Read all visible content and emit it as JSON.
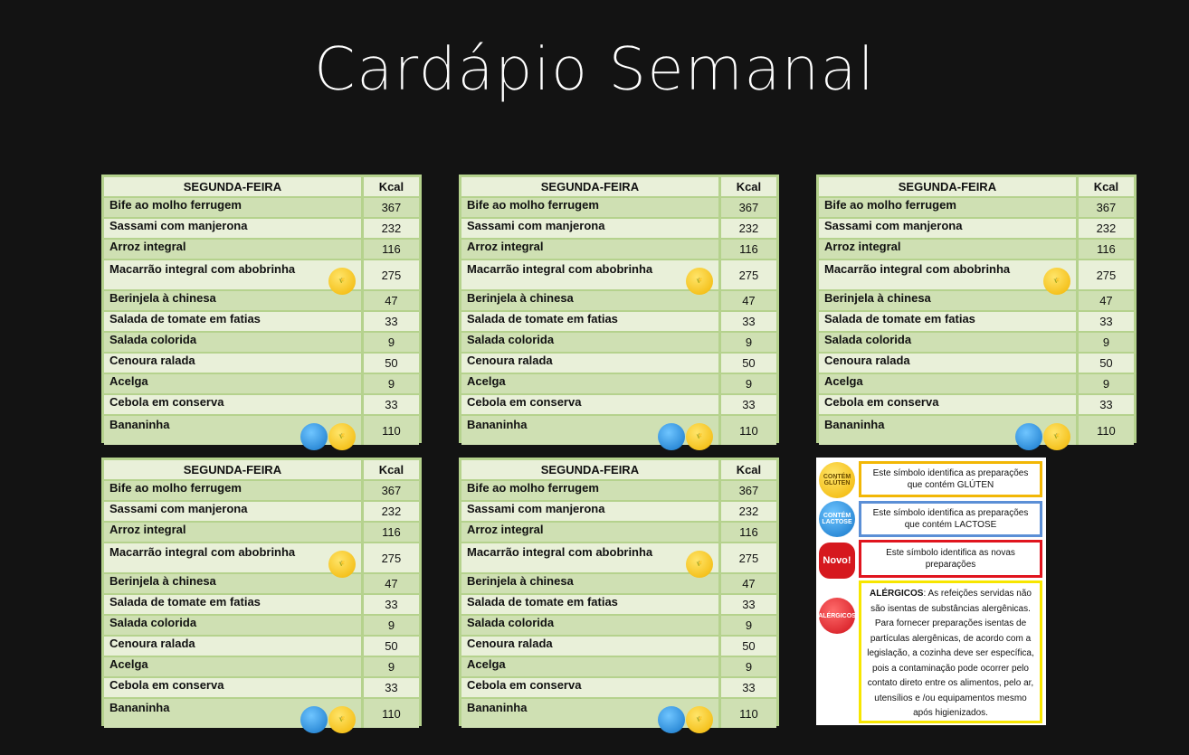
{
  "page": {
    "title": "Cardápio Semanal"
  },
  "menu": {
    "day_header": "SEGUNDA-FEIRA",
    "kcal_header": "Kcal",
    "items": [
      {
        "name": "Bife ao molho ferrugem",
        "kcal": "367",
        "badges": []
      },
      {
        "name": "Sassami com manjerona",
        "kcal": "232",
        "badges": []
      },
      {
        "name": "Arroz integral",
        "kcal": "116",
        "badges": []
      },
      {
        "name": "Macarrão integral com abobrinha",
        "kcal": "275",
        "badges": [
          "gluten"
        ]
      },
      {
        "name": "Berinjela à chinesa",
        "kcal": "47",
        "badges": []
      },
      {
        "name": "Salada de tomate em fatias",
        "kcal": "33",
        "badges": []
      },
      {
        "name": "Salada colorida",
        "kcal": "9",
        "badges": []
      },
      {
        "name": "Cenoura ralada",
        "kcal": "50",
        "badges": []
      },
      {
        "name": "Acelga",
        "kcal": "9",
        "badges": []
      },
      {
        "name": "Cebola em conserva",
        "kcal": "33",
        "badges": []
      },
      {
        "name": "Bananinha",
        "kcal": "110",
        "badges": [
          "lactose",
          "gluten"
        ]
      }
    ]
  },
  "badge_labels": {
    "gluten": "CONTÉM GLÚTEN",
    "lactose": "CONTÉM LACTOSE"
  },
  "legend": {
    "gluten": {
      "icon_label": "CONTÉM GLÚTEN",
      "text": "Este símbolo identifica as preparações que contém GLÚTEN",
      "color": "#f2b705"
    },
    "lactose": {
      "icon_label": "CONTÉM LACTOSE",
      "text": "Este símbolo identifica as preparações que contém LACTOSE",
      "color": "#5b8fd6"
    },
    "novo": {
      "icon_label": "Novo!",
      "text": "Este símbolo identifica as novas preparações",
      "color": "#e0141e"
    },
    "alergicos": {
      "icon_label": "ALÉRGICOS",
      "title": "ALÉRGICOS",
      "text": ": As refeições servidas não são isentas de substâncias alergênicas. Para fornecer preparações isentas de partículas alergênicas, de acordo com a legislação, a cozinha deve ser específica, pois a contaminação pode ocorrer pelo contato direto entre os alimentos, pelo ar, utensílios e /ou equipamentos mesmo após higienizados.",
      "color": "#f7e600"
    }
  }
}
